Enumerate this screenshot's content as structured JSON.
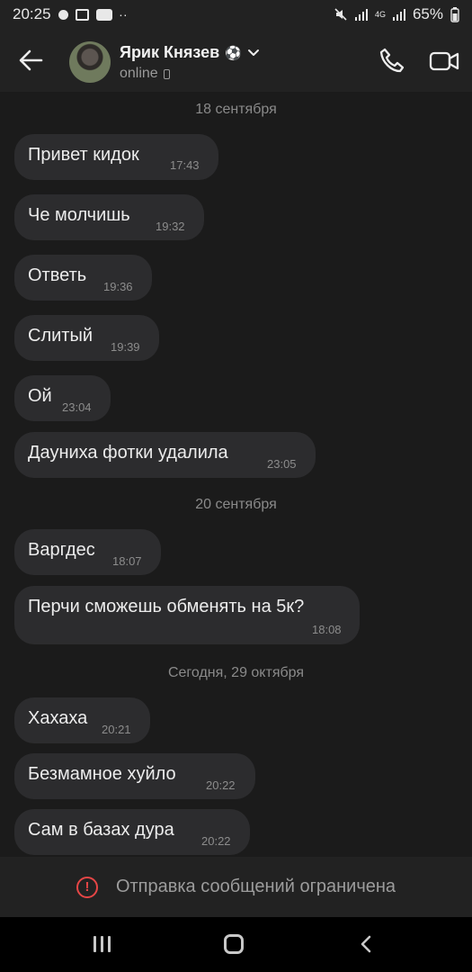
{
  "statusbar": {
    "time": "20:25",
    "lte": "4G",
    "battery": "65%"
  },
  "header": {
    "name": "Ярик Князев",
    "badge": "⚽",
    "status": "online"
  },
  "dates": [
    "18 сентября",
    "20 сентября",
    "Сегодня, 29 октября"
  ],
  "messages": [
    {
      "text": "Привет кидок",
      "time": "17:43"
    },
    {
      "text": "Че молчишь",
      "time": "19:32"
    },
    {
      "text": "Ответь",
      "time": "19:36"
    },
    {
      "text": "Слитый",
      "time": "19:39"
    },
    {
      "text": "Ой",
      "time": "23:04"
    },
    {
      "text": "Дауниха фотки удалила",
      "time": "23:05"
    },
    {
      "text": "Варгдес",
      "time": "18:07"
    },
    {
      "text": "Перчи сможешь обменять на 5к?",
      "time": "18:08"
    },
    {
      "text": "Хахаха",
      "time": "20:21"
    },
    {
      "text": "Безмамное хуйло",
      "time": "20:22"
    },
    {
      "text": "Сам в базах дура",
      "time": "20:22"
    }
  ],
  "restriction": {
    "text": "Отправка сообщений ограничена",
    "icon": "!"
  },
  "icons": {
    "back": "arrow-left-icon",
    "call": "phone-icon",
    "video": "video-camera-icon",
    "warning": "warning-icon",
    "nav_recents": "recents-icon",
    "nav_home": "home-icon",
    "nav_back": "chevron-left-icon"
  },
  "colors": {
    "background": "#1b1b1b",
    "bubble": "#2c2c2e",
    "bar": "#222222",
    "warning": "#e64646"
  }
}
